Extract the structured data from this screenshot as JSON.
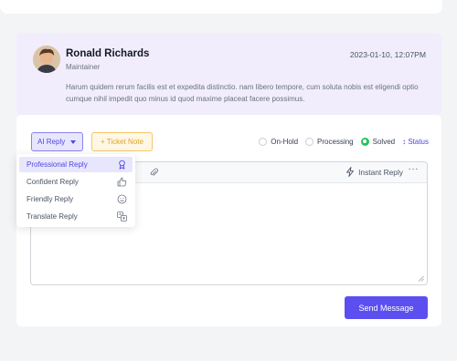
{
  "message": {
    "author_name": "Ronald Richards",
    "author_role": "Maintainer",
    "timestamp": "2023-01-10, 12:07PM",
    "body": "Harum quidem rerum facilis est et expedita distinctio. nam libero tempore, cum soluta nobis est eligendi optio cumque nihil impedit quo minus id quod maxime placeat facere possimus."
  },
  "compose": {
    "ai_reply_label": "AI Reply",
    "ticket_note_label": "+ Ticket Note",
    "status_options": [
      {
        "label": "On-Hold",
        "checked": false
      },
      {
        "label": "Processing",
        "checked": false
      },
      {
        "label": "Solved",
        "checked": true
      }
    ],
    "status_link": "↕ Status",
    "instant_reply_label": "Instant Reply",
    "more_label": "···",
    "bracket_glyph": "]",
    "send_label": "Send Message"
  },
  "ai_reply_menu": {
    "items": [
      {
        "label": "Professional Reply",
        "icon": "badge-icon",
        "active": true
      },
      {
        "label": "Confident Reply",
        "icon": "thumbs-up-icon",
        "active": false
      },
      {
        "label": "Friendly Reply",
        "icon": "smile-icon",
        "active": false
      },
      {
        "label": "Translate Reply",
        "icon": "translate-icon",
        "active": false
      }
    ]
  },
  "colors": {
    "accent": "#5b4ff0",
    "message_bg": "#f1edfd",
    "ticket_note": "#f6c766",
    "solved": "#22c55e"
  }
}
